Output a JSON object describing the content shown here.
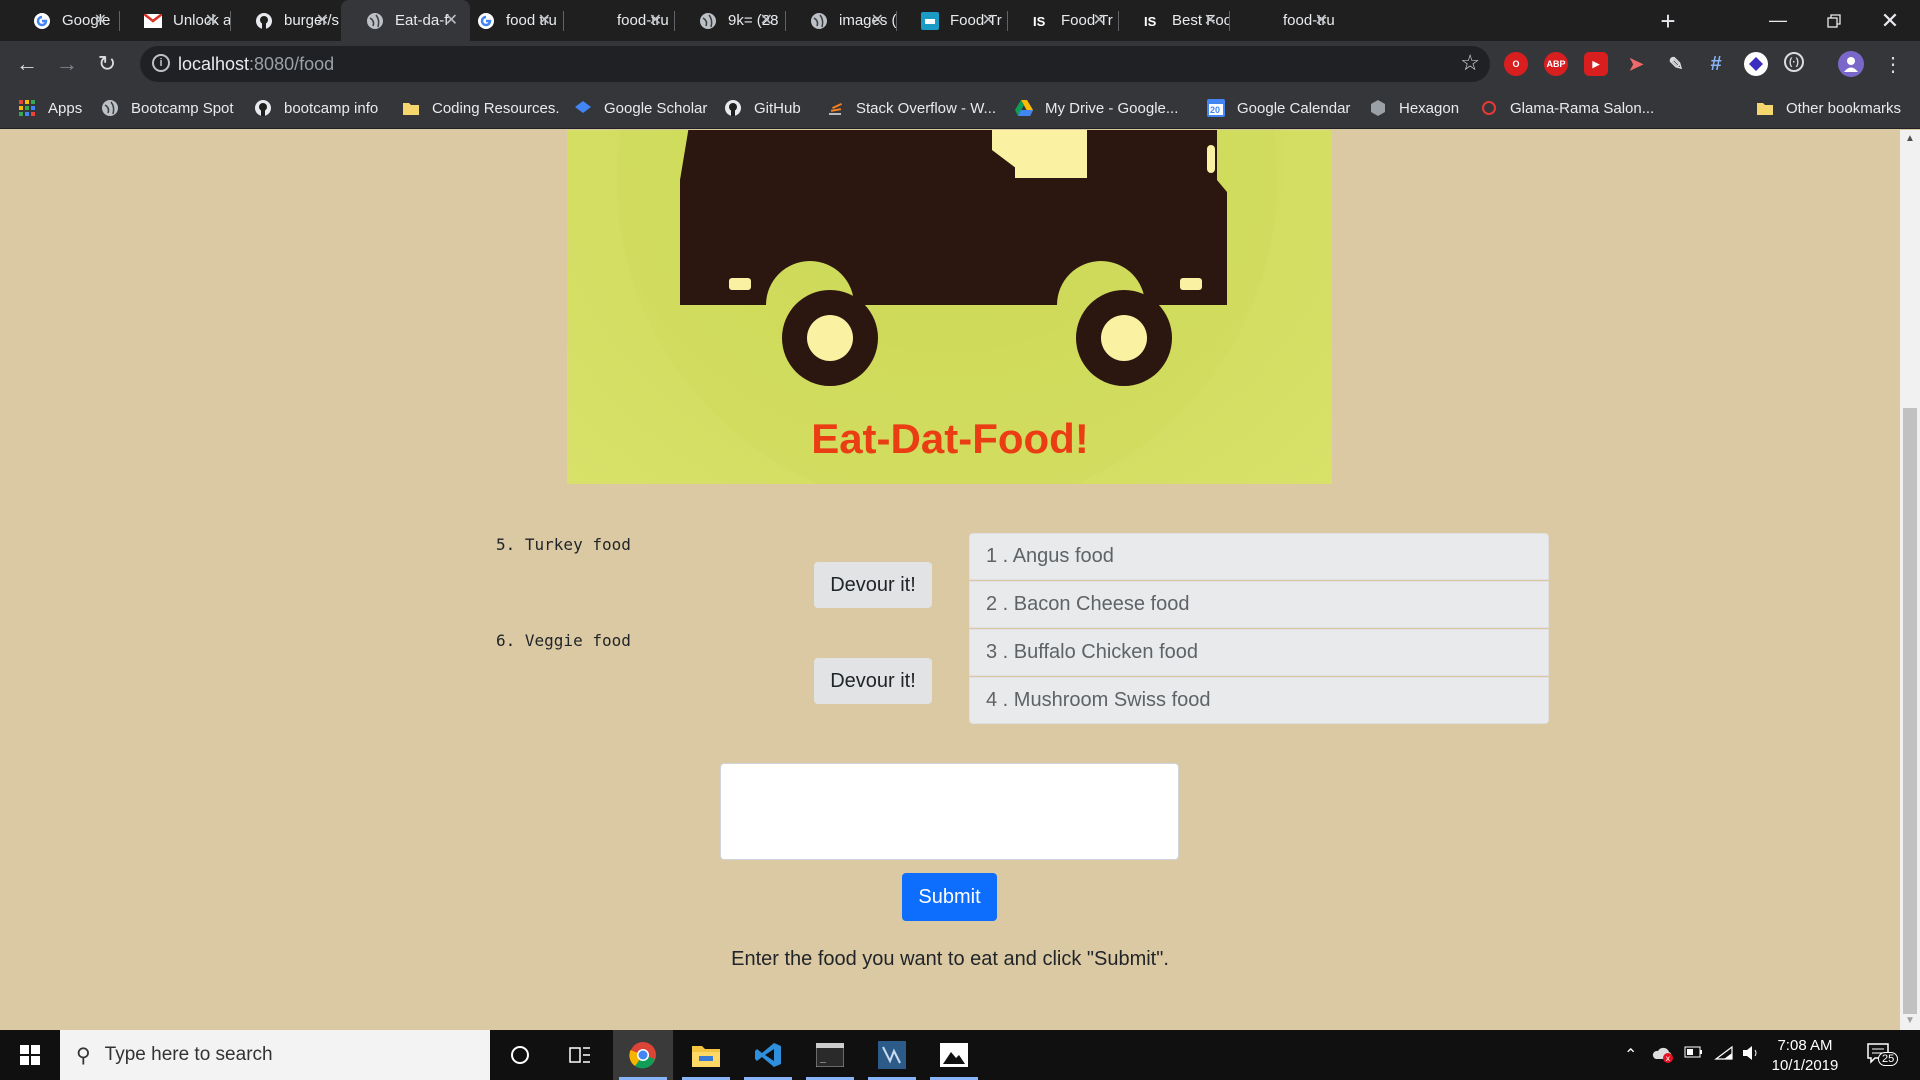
{
  "browser": {
    "tabs": [
      {
        "title": "Google",
        "icon": "google-icon",
        "active": false
      },
      {
        "title": "Unlock a",
        "icon": "gmail-icon",
        "active": false
      },
      {
        "title": "burger/s",
        "icon": "github-icon",
        "active": false
      },
      {
        "title": "Eat-da-f",
        "icon": "globe-icon",
        "active": true
      },
      {
        "title": "food tru",
        "icon": "google-icon",
        "active": false
      },
      {
        "title": "food-tru",
        "icon": "blank-icon",
        "active": false
      },
      {
        "title": "9k= (28",
        "icon": "globe-icon",
        "active": false
      },
      {
        "title": "images (",
        "icon": "globe-icon",
        "active": false
      },
      {
        "title": "Food Tr",
        "icon": "food-truck-app-icon",
        "active": false
      },
      {
        "title": "Food Tr",
        "icon": "is-icon",
        "active": false
      },
      {
        "title": "Best Foo",
        "icon": "is-icon",
        "active": false
      },
      {
        "title": "food-tru",
        "icon": "blank-icon",
        "active": false
      }
    ],
    "url_host": "localhost",
    "url_path": ":8080/food",
    "bookmarks": [
      {
        "label": "Apps",
        "icon": "apps-grid-icon"
      },
      {
        "label": "Bootcamp Spot",
        "icon": "globe-icon"
      },
      {
        "label": "bootcamp info",
        "icon": "github-icon"
      },
      {
        "label": "Coding Resources.",
        "icon": "folder-icon"
      },
      {
        "label": "Google Scholar",
        "icon": "scholar-icon"
      },
      {
        "label": "GitHub",
        "icon": "github-icon"
      },
      {
        "label": "Stack Overflow - W...",
        "icon": "stackoverflow-icon"
      },
      {
        "label": "My Drive - Google...",
        "icon": "drive-icon"
      },
      {
        "label": "Google Calendar",
        "icon": "calendar-icon"
      },
      {
        "label": "Hexagon",
        "icon": "hexagon-icon"
      },
      {
        "label": "Glama-Rama Salon...",
        "icon": "salon-icon"
      }
    ],
    "other_bookmarks": "Other bookmarks",
    "calendar_day": "20",
    "extensions": {
      "opera_label": "O",
      "abp_label": "ABP",
      "twitch_label": "▶"
    }
  },
  "page": {
    "title": "Eat-Dat-Food!",
    "eaten": [
      {
        "text": "5. Turkey food"
      },
      {
        "text": "6. Veggie food"
      }
    ],
    "devour_label": "Devour it!",
    "foods": [
      {
        "text": "1 . Angus food"
      },
      {
        "text": "2 . Bacon Cheese food"
      },
      {
        "text": "3 . Buffalo Chicken food"
      },
      {
        "text": "4 . Mushroom Swiss food"
      }
    ],
    "input_value": "",
    "submit_label": "Submit",
    "instructions": "Enter the food you want to eat and click \"Submit\"."
  },
  "taskbar": {
    "search_placeholder": "Type here to search",
    "time": "7:08 AM",
    "date": "10/1/2019",
    "notification_count": "25"
  },
  "colors": {
    "page_bg": "#dbc9a3",
    "title": "#ea3d14",
    "submit_bg": "#0d6efd",
    "hero_bg": "#d1dc5e",
    "truck": "#2c1610"
  }
}
